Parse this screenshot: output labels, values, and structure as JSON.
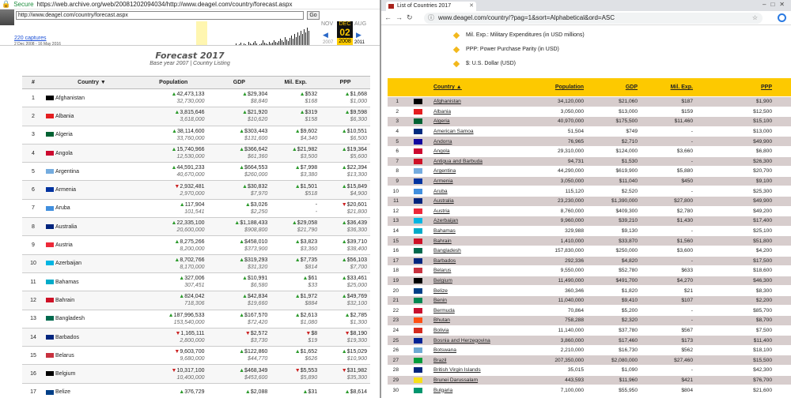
{
  "left": {
    "secure_label": "Secure",
    "address": "https://web.archive.org/web/20081202094034/http://www.deagel.com/country/forecast.aspx",
    "wayback": {
      "input_url": "http://www.deagel.com/country/forecast.aspx",
      "go_label": "Go",
      "captures": "220 captures",
      "range": "2 Dec 2008 - 16 May 2016",
      "prev_month": "NOV",
      "cur_month": "DEC",
      "cur_day": "02",
      "cur_year": "2008",
      "next_month": "AUG",
      "prev_year": "2007",
      "next_year": "2011"
    },
    "title": "Forecast 2017",
    "subtitle_base": "Base year 2007",
    "subtitle_sep": " | ",
    "subtitle_link": "Country Listing",
    "headers": [
      "#",
      "Country ▼",
      "Population",
      "GDP",
      "Mil. Exp.",
      "PPP"
    ],
    "rows": [
      {
        "n": "1",
        "country": "Afghanistan",
        "flag": "#000000",
        "pop": [
          "▲",
          "42,473,133",
          "32,730,000"
        ],
        "gdp": [
          "▲",
          "$29,304",
          "$8,840"
        ],
        "mil": [
          "▲",
          "$532",
          "$168"
        ],
        "ppp": [
          "▲",
          "$1,668",
          "$1,000"
        ]
      },
      {
        "n": "2",
        "country": "Albania",
        "flag": "#e41e20",
        "pop": [
          "▲",
          "3,815,646",
          "3,618,000"
        ],
        "gdp": [
          "▲",
          "$21,920",
          "$10,620"
        ],
        "mil": [
          "▲",
          "$319",
          "$158"
        ],
        "ppp": [
          "▲",
          "$9,598",
          "$6,300"
        ]
      },
      {
        "n": "3",
        "country": "Algeria",
        "flag": "#006233",
        "pop": [
          "▲",
          "38,114,600",
          "33,760,000"
        ],
        "gdp": [
          "▲",
          "$303,443",
          "$131,600"
        ],
        "mil": [
          "▲",
          "$9,602",
          "$4,340"
        ],
        "ppp": [
          "▲",
          "$10,551",
          "$6,500"
        ]
      },
      {
        "n": "4",
        "country": "Angola",
        "flag": "#cc092f",
        "pop": [
          "▲",
          "15,740,966",
          "12,530,000"
        ],
        "gdp": [
          "▲",
          "$366,642",
          "$61,360"
        ],
        "mil": [
          "▲",
          "$21,982",
          "$3,500"
        ],
        "ppp": [
          "▲",
          "$19,364",
          "$5,600"
        ]
      },
      {
        "n": "5",
        "country": "Argentina",
        "flag": "#74acdf",
        "pop": [
          "▲",
          "44,591,233",
          "40,670,000"
        ],
        "gdp": [
          "▲",
          "$664,553",
          "$260,000"
        ],
        "mil": [
          "▲",
          "$7,998",
          "$3,380"
        ],
        "ppp": [
          "▲",
          "$22,394",
          "$13,300"
        ]
      },
      {
        "n": "6",
        "country": "Armenia",
        "flag": "#0033a0",
        "pop": [
          "▼",
          "2,932,481",
          "2,970,000"
        ],
        "gdp": [
          "▲",
          "$30,832",
          "$7,970"
        ],
        "mil": [
          "▲",
          "$1,501",
          "$518"
        ],
        "ppp": [
          "▲",
          "$15,849",
          "$4,900"
        ]
      },
      {
        "n": "7",
        "country": "Aruba",
        "flag": "#418fde",
        "pop": [
          "▲",
          "117,904",
          "101,541"
        ],
        "gdp": [
          "▲",
          "$3,026",
          "$2,250"
        ],
        "mil": [
          "",
          "-",
          "-"
        ],
        "ppp": [
          "▼",
          "$20,601",
          "$21,800"
        ]
      },
      {
        "n": "8",
        "country": "Australia",
        "flag": "#00247d",
        "pop": [
          "▲",
          "22,335,100",
          "20,600,000"
        ],
        "gdp": [
          "▲",
          "$1,188,433",
          "$908,800"
        ],
        "mil": [
          "▲",
          "$29,058",
          "$21,790"
        ],
        "ppp": [
          "▲",
          "$36,439",
          "$36,300"
        ]
      },
      {
        "n": "9",
        "country": "Austria",
        "flag": "#ed2939",
        "pop": [
          "▲",
          "8,275,266",
          "8,200,000"
        ],
        "gdp": [
          "▲",
          "$458,010",
          "$373,900"
        ],
        "mil": [
          "▲",
          "$3,823",
          "$3,360"
        ],
        "ppp": [
          "▲",
          "$39,710",
          "$38,400"
        ]
      },
      {
        "n": "10",
        "country": "Azerbaijan",
        "flag": "#00b5e2",
        "pop": [
          "▲",
          "8,702,766",
          "8,170,000"
        ],
        "gdp": [
          "▲",
          "$319,293",
          "$31,320"
        ],
        "mil": [
          "▲",
          "$7,735",
          "$814"
        ],
        "ppp": [
          "▲",
          "$56,103",
          "$7,700"
        ]
      },
      {
        "n": "11",
        "country": "Bahamas",
        "flag": "#00abc9",
        "pop": [
          "▲",
          "327,006",
          "307,451"
        ],
        "gdp": [
          "▲",
          "$10,991",
          "$6,580"
        ],
        "mil": [
          "▲",
          "$61",
          "$33"
        ],
        "ppp": [
          "▲",
          "$33,461",
          "$25,000"
        ]
      },
      {
        "n": "12",
        "country": "Bahrain",
        "flag": "#ce1126",
        "pop": [
          "▲",
          "824,042",
          "718,306"
        ],
        "gdp": [
          "▲",
          "$42,834",
          "$19,660"
        ],
        "mil": [
          "▲",
          "$1,972",
          "$884"
        ],
        "ppp": [
          "▲",
          "$49,769",
          "$32,100"
        ]
      },
      {
        "n": "13",
        "country": "Bangladesh",
        "flag": "#006a4e",
        "pop": [
          "▲",
          "187,996,533",
          "153,540,000"
        ],
        "gdp": [
          "▲",
          "$167,570",
          "$72,420"
        ],
        "mil": [
          "▲",
          "$2,613",
          "$1,080"
        ],
        "ppp": [
          "▲",
          "$2,785",
          "$1,300"
        ]
      },
      {
        "n": "14",
        "country": "Barbados",
        "flag": "#00267f",
        "pop": [
          "▼",
          "1,165,111",
          "2,800,000"
        ],
        "gdp": [
          "▼",
          "$2,572",
          "$3,730"
        ],
        "mil": [
          "▼",
          "$8",
          "$19"
        ],
        "ppp": [
          "▼",
          "$8,190",
          "$19,300"
        ]
      },
      {
        "n": "15",
        "country": "Belarus",
        "flag": "#c8313e",
        "pop": [
          "▼",
          "9,603,700",
          "9,680,000"
        ],
        "gdp": [
          "▲",
          "$122,860",
          "$44,770"
        ],
        "mil": [
          "▲",
          "$1,652",
          "$626"
        ],
        "ppp": [
          "▲",
          "$15,029",
          "$10,900"
        ]
      },
      {
        "n": "16",
        "country": "Belgium",
        "flag": "#000000",
        "pop": [
          "▼",
          "10,317,100",
          "10,400,000"
        ],
        "gdp": [
          "▲",
          "$468,349",
          "$453,600"
        ],
        "mil": [
          "▼",
          "$5,553",
          "$5,890"
        ],
        "ppp": [
          "▼",
          "$31,982",
          "$35,300"
        ]
      },
      {
        "n": "17",
        "country": "Belize",
        "flag": "#003f87",
        "pop": [
          "▲",
          "376,729",
          ""
        ],
        "gdp": [
          "▲",
          "$2,088",
          ""
        ],
        "mil": [
          "▲",
          "$31",
          ""
        ],
        "ppp": [
          "▲",
          "$8,614",
          ""
        ]
      }
    ]
  },
  "right": {
    "tab_title": "List of Countries 2017",
    "url": "www.deagel.com/country/?pag=1&sort=Alphabetical&ord=ASC",
    "defs": [
      "Mil. Exp.: Military Expenditures (in USD millions)",
      "PPP: Power Purchase Parity (in USD)",
      "$: U.S. Dollar (USD)"
    ],
    "headers": {
      "country": "Country ▲",
      "population": "Population",
      "gdp": "GDP",
      "mil": "Mil. Exp.",
      "ppp": "PPP"
    },
    "rows": [
      {
        "n": "1",
        "c": "Afghanistan",
        "flag": "#000000",
        "p": "34,120,000",
        "g": "$21,060",
        "m": "$187",
        "pp": "$1,900"
      },
      {
        "n": "2",
        "c": "Albania",
        "flag": "#e41e20",
        "p": "3,050,000",
        "g": "$13,000",
        "m": "$159",
        "pp": "$12,500"
      },
      {
        "n": "3",
        "c": "Algeria",
        "flag": "#006233",
        "p": "40,970,000",
        "g": "$175,500",
        "m": "$11,460",
        "pp": "$15,100"
      },
      {
        "n": "4",
        "c": "American Samoa",
        "flag": "#002b7f",
        "p": "51,504",
        "g": "$749",
        "m": "-",
        "pp": "$13,000"
      },
      {
        "n": "5",
        "c": "Andorra",
        "flag": "#10069f",
        "p": "76,965",
        "g": "$2,710",
        "m": "-",
        "pp": "$49,900"
      },
      {
        "n": "6",
        "c": "Angola",
        "flag": "#cc092f",
        "p": "29,310,000",
        "g": "$124,000",
        "m": "$3,660",
        "pp": "$6,800"
      },
      {
        "n": "7",
        "c": "Antigua and Barbuda",
        "flag": "#ce1126",
        "p": "94,731",
        "g": "$1,530",
        "m": "-",
        "pp": "$26,300"
      },
      {
        "n": "8",
        "c": "Argentina",
        "flag": "#74acdf",
        "p": "44,290,000",
        "g": "$619,900",
        "m": "$5,880",
        "pp": "$20,700"
      },
      {
        "n": "9",
        "c": "Armenia",
        "flag": "#0033a0",
        "p": "3,050,000",
        "g": "$11,040",
        "m": "$450",
        "pp": "$9,100"
      },
      {
        "n": "10",
        "c": "Aruba",
        "flag": "#418fde",
        "p": "115,120",
        "g": "$2,520",
        "m": "-",
        "pp": "$25,300"
      },
      {
        "n": "11",
        "c": "Australia",
        "flag": "#00247d",
        "p": "23,230,000",
        "g": "$1,390,000",
        "m": "$27,800",
        "pp": "$49,900"
      },
      {
        "n": "12",
        "c": "Austria",
        "flag": "#ed2939",
        "p": "8,760,000",
        "g": "$409,300",
        "m": "$2,780",
        "pp": "$49,200"
      },
      {
        "n": "13",
        "c": "Azerbaijan",
        "flag": "#00b5e2",
        "p": "9,960,000",
        "g": "$39,210",
        "m": "$1,430",
        "pp": "$17,400"
      },
      {
        "n": "14",
        "c": "Bahamas",
        "flag": "#00abc9",
        "p": "329,988",
        "g": "$9,130",
        "m": "-",
        "pp": "$25,100"
      },
      {
        "n": "15",
        "c": "Bahrain",
        "flag": "#ce1126",
        "p": "1,410,000",
        "g": "$33,870",
        "m": "$1,560",
        "pp": "$51,800"
      },
      {
        "n": "16",
        "c": "Bangladesh",
        "flag": "#006a4e",
        "p": "157,830,000",
        "g": "$250,000",
        "m": "$3,600",
        "pp": "$4,200"
      },
      {
        "n": "17",
        "c": "Barbados",
        "flag": "#00267f",
        "p": "292,336",
        "g": "$4,820",
        "m": "-",
        "pp": "$17,500"
      },
      {
        "n": "18",
        "c": "Belarus",
        "flag": "#c8313e",
        "p": "9,550,000",
        "g": "$52,780",
        "m": "$633",
        "pp": "$18,600"
      },
      {
        "n": "19",
        "c": "Belgium",
        "flag": "#000000",
        "p": "11,490,000",
        "g": "$491,700",
        "m": "$4,270",
        "pp": "$46,300"
      },
      {
        "n": "20",
        "c": "Belize",
        "flag": "#003f87",
        "p": "360,346",
        "g": "$1,820",
        "m": "$21",
        "pp": "$8,300"
      },
      {
        "n": "21",
        "c": "Benin",
        "flag": "#008751",
        "p": "11,040,000",
        "g": "$9,410",
        "m": "$107",
        "pp": "$2,200"
      },
      {
        "n": "22",
        "c": "Bermuda",
        "flag": "#c8102e",
        "p": "70,864",
        "g": "$5,200",
        "m": "-",
        "pp": "$85,700"
      },
      {
        "n": "23",
        "c": "Bhutan",
        "flag": "#ff4e12",
        "p": "758,288",
        "g": "$2,320",
        "m": "-",
        "pp": "$8,700"
      },
      {
        "n": "24",
        "c": "Bolivia",
        "flag": "#d52b1e",
        "p": "11,140,000",
        "g": "$37,780",
        "m": "$567",
        "pp": "$7,500"
      },
      {
        "n": "25",
        "c": "Bosnia and Herzegovina",
        "flag": "#002395",
        "p": "3,860,000",
        "g": "$17,460",
        "m": "$173",
        "pp": "$11,400"
      },
      {
        "n": "26",
        "c": "Botswana",
        "flag": "#6da9d2",
        "p": "2,210,000",
        "g": "$16,730",
        "m": "$562",
        "pp": "$18,100"
      },
      {
        "n": "27",
        "c": "Brazil",
        "flag": "#009c3b",
        "p": "207,350,000",
        "g": "$2,080,000",
        "m": "$27,460",
        "pp": "$15,500"
      },
      {
        "n": "28",
        "c": "British Virgin Islands",
        "flag": "#00247d",
        "p": "35,015",
        "g": "$1,090",
        "m": "-",
        "pp": "$42,300"
      },
      {
        "n": "29",
        "c": "Brunei Darussalam",
        "flag": "#f7e017",
        "p": "443,593",
        "g": "$11,960",
        "m": "$421",
        "pp": "$76,700"
      },
      {
        "n": "30",
        "c": "Bulgaria",
        "flag": "#00966e",
        "p": "7,100,000",
        "g": "$55,950",
        "m": "$804",
        "pp": "$21,600"
      }
    ]
  }
}
